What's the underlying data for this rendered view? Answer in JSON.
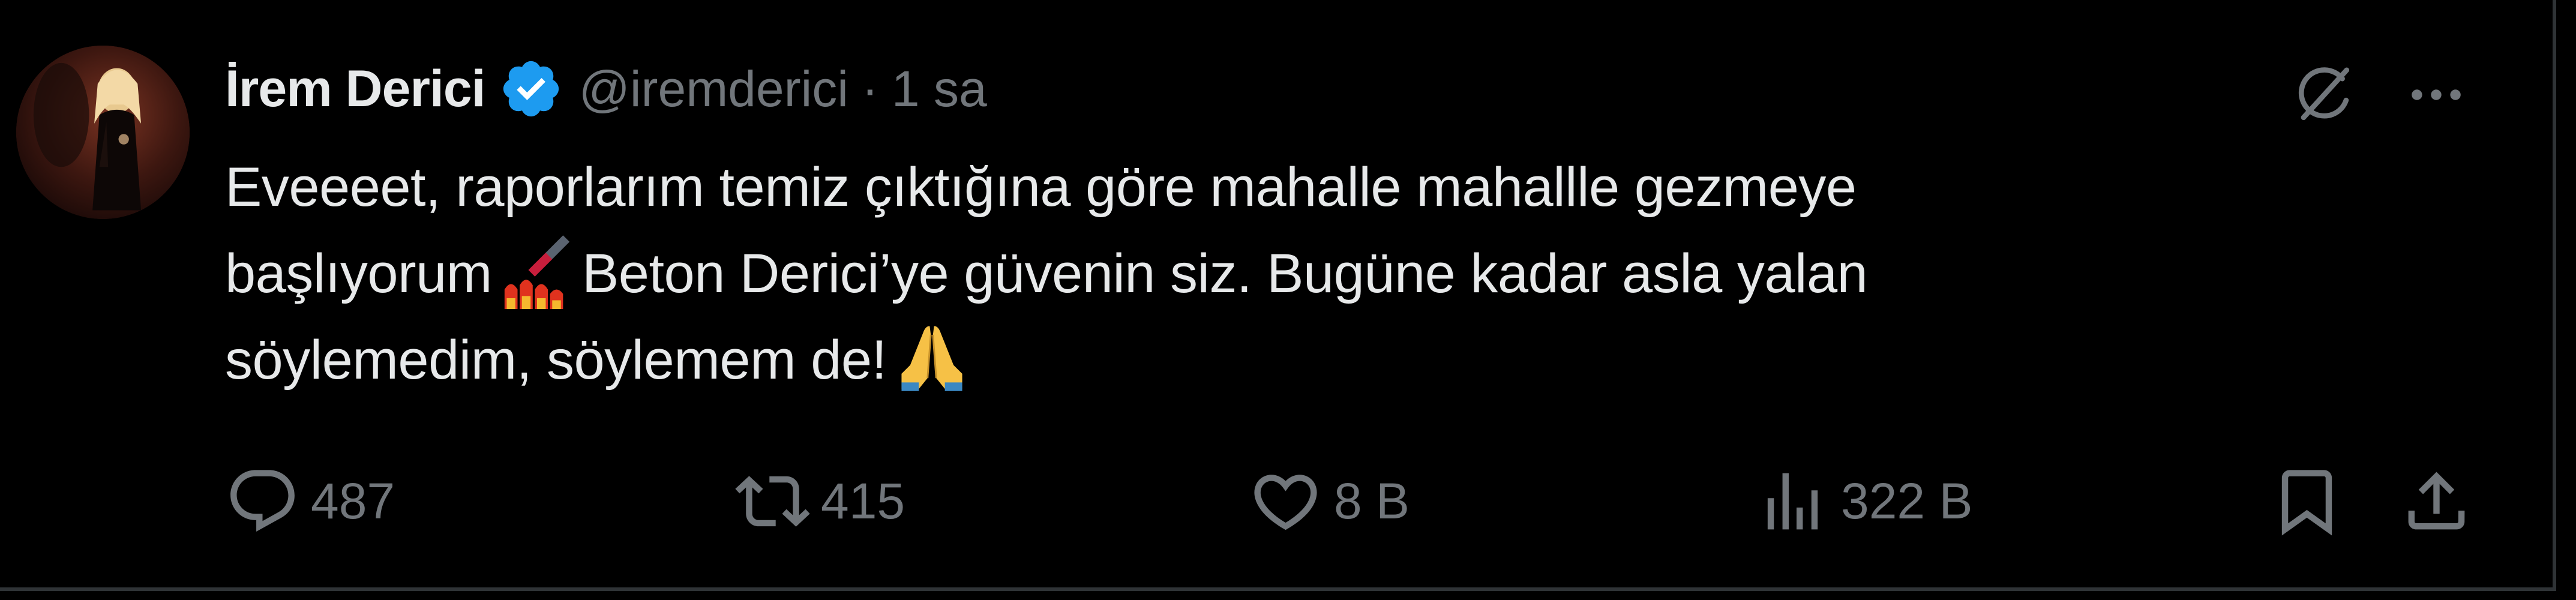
{
  "tweet": {
    "author": {
      "display_name": "İrem Derici",
      "handle": "@iremderici",
      "verified": true,
      "avatar_icon": "avatar"
    },
    "separator": "·",
    "time": "1 sa",
    "text_lines": [
      "Eveeeet, raporlarım temiz çıktığına göre mahalle mahallle gezmeye",
      "başlıyorum",
      "Beton Derici’ye güvenin siz. Bugüne kadar asla yalan",
      "söylemedim, söylemem de!"
    ],
    "emojis": [
      "nail-polish-emoji",
      "folded-hands-emoji"
    ],
    "stats": {
      "replies": "487",
      "retweets": "415",
      "likes": "8 B",
      "views": "322 B"
    }
  },
  "icons": {
    "verified": "verified-badge-icon",
    "grok": "grok-icon",
    "more": "more-icon",
    "reply": "reply-icon",
    "retweet": "retweet-icon",
    "like": "heart-icon",
    "views": "views-icon",
    "bookmark": "bookmark-icon",
    "share": "share-icon"
  },
  "colors": {
    "background": "#000000",
    "text": "#e7e9ea",
    "muted": "#71767b",
    "verified": "#1d9bf0",
    "border": "#2f3336"
  }
}
